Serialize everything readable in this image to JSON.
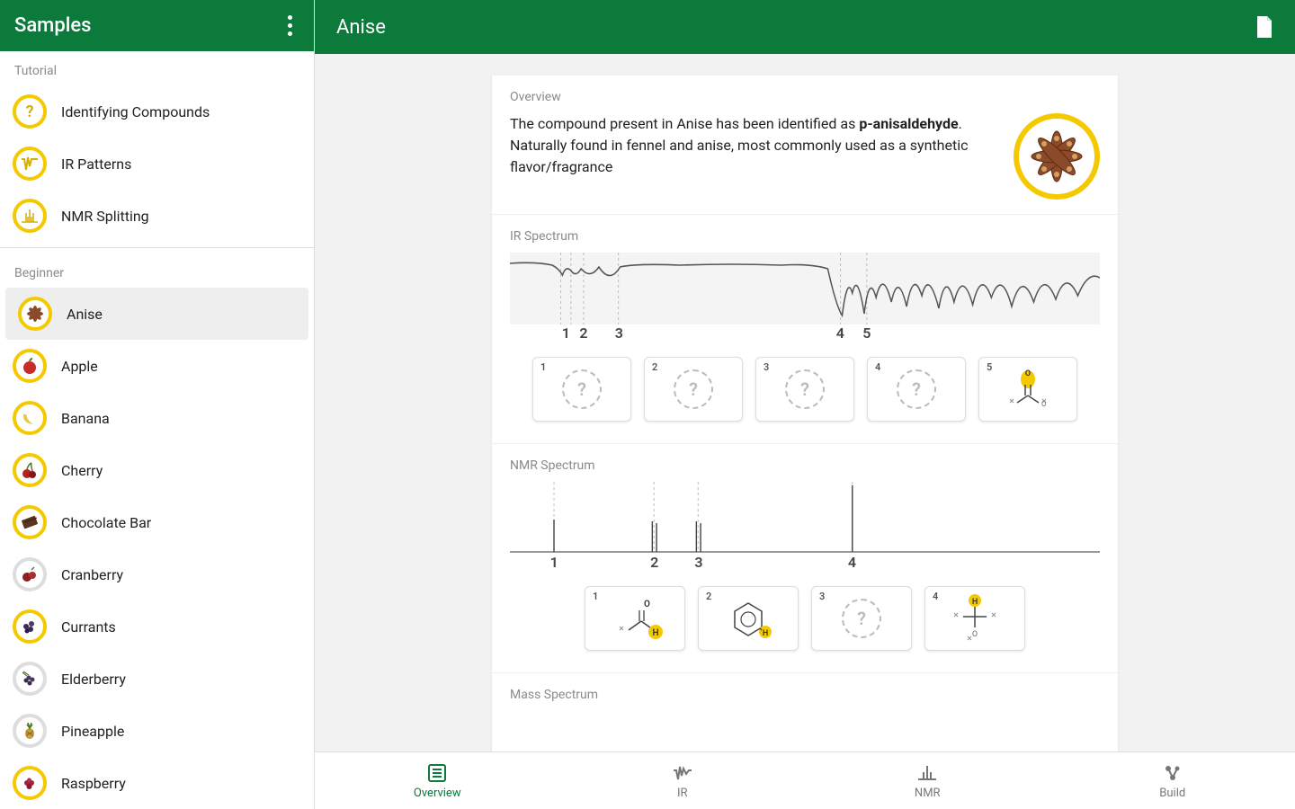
{
  "sidebar": {
    "title": "Samples",
    "tutorial_label": "Tutorial",
    "beginner_label": "Beginner",
    "tutorials": [
      {
        "label": "Identifying Compounds",
        "icon": "question"
      },
      {
        "label": "IR Patterns",
        "icon": "ir"
      },
      {
        "label": "NMR Splitting",
        "icon": "nmr"
      }
    ],
    "samples": [
      {
        "label": "Anise",
        "ring": "yellow",
        "selected": true
      },
      {
        "label": "Apple",
        "ring": "yellow"
      },
      {
        "label": "Banana",
        "ring": "yellow"
      },
      {
        "label": "Cherry",
        "ring": "yellow"
      },
      {
        "label": "Chocolate Bar",
        "ring": "yellow"
      },
      {
        "label": "Cranberry",
        "ring": "grey"
      },
      {
        "label": "Currants",
        "ring": "yellow"
      },
      {
        "label": "Elderberry",
        "ring": "grey"
      },
      {
        "label": "Pineapple",
        "ring": "grey"
      },
      {
        "label": "Raspberry",
        "ring": "yellow"
      }
    ]
  },
  "header": {
    "title": "Anise"
  },
  "overview": {
    "section_title": "Overview",
    "text_prefix": "The compound present in Anise has been identified as ",
    "compound": "p-anisaldehyde",
    "text_suffix": ". Naturally found in fennel and anise, most commonly used as a synthetic flavor/fragrance"
  },
  "ir": {
    "section_title": "IR Spectrum",
    "peaks": [
      "1",
      "2",
      "3",
      "4",
      "5"
    ],
    "peak_positions_pct": [
      9.5,
      12.5,
      18.5,
      56.0,
      60.5
    ],
    "cards": [
      {
        "num": "1",
        "known": false
      },
      {
        "num": "2",
        "known": false
      },
      {
        "num": "3",
        "known": false
      },
      {
        "num": "4",
        "known": false
      },
      {
        "num": "5",
        "known": true,
        "icon": "carbonyl"
      }
    ]
  },
  "nmr": {
    "section_title": "NMR Spectrum",
    "peaks": [
      "1",
      "2",
      "3",
      "4"
    ],
    "peak_positions_pct": [
      7.5,
      24.5,
      32.0,
      58.0
    ],
    "cards": [
      {
        "num": "1",
        "known": true,
        "icon": "aldehyde-h"
      },
      {
        "num": "2",
        "known": true,
        "icon": "benzene-h"
      },
      {
        "num": "3",
        "known": false
      },
      {
        "num": "4",
        "known": true,
        "icon": "och3"
      }
    ]
  },
  "mass": {
    "section_title": "Mass Spectrum"
  },
  "tabs": {
    "overview": "Overview",
    "ir": "IR",
    "nmr": "NMR",
    "build": "Build"
  },
  "chart_data": [
    {
      "type": "line",
      "name": "IR Spectrum",
      "note": "absorption peaks labeled 1-5; x positions in percent of card width",
      "labeled_peaks": [
        {
          "label": "1",
          "x_pct": 9.5
        },
        {
          "label": "2",
          "x_pct": 12.5
        },
        {
          "label": "3",
          "x_pct": 18.5
        },
        {
          "label": "4",
          "x_pct": 56.0
        },
        {
          "label": "5",
          "x_pct": 60.5
        }
      ]
    },
    {
      "type": "line",
      "name": "NMR Spectrum",
      "note": "sharp singlets labeled 1-4; x positions in percent of card width; peak 4 tallest",
      "labeled_peaks": [
        {
          "label": "1",
          "x_pct": 7.5,
          "rel_height": 0.55
        },
        {
          "label": "2",
          "x_pct": 24.5,
          "rel_height": 0.5
        },
        {
          "label": "3",
          "x_pct": 32.0,
          "rel_height": 0.5
        },
        {
          "label": "4",
          "x_pct": 58.0,
          "rel_height": 1.0
        }
      ]
    }
  ]
}
